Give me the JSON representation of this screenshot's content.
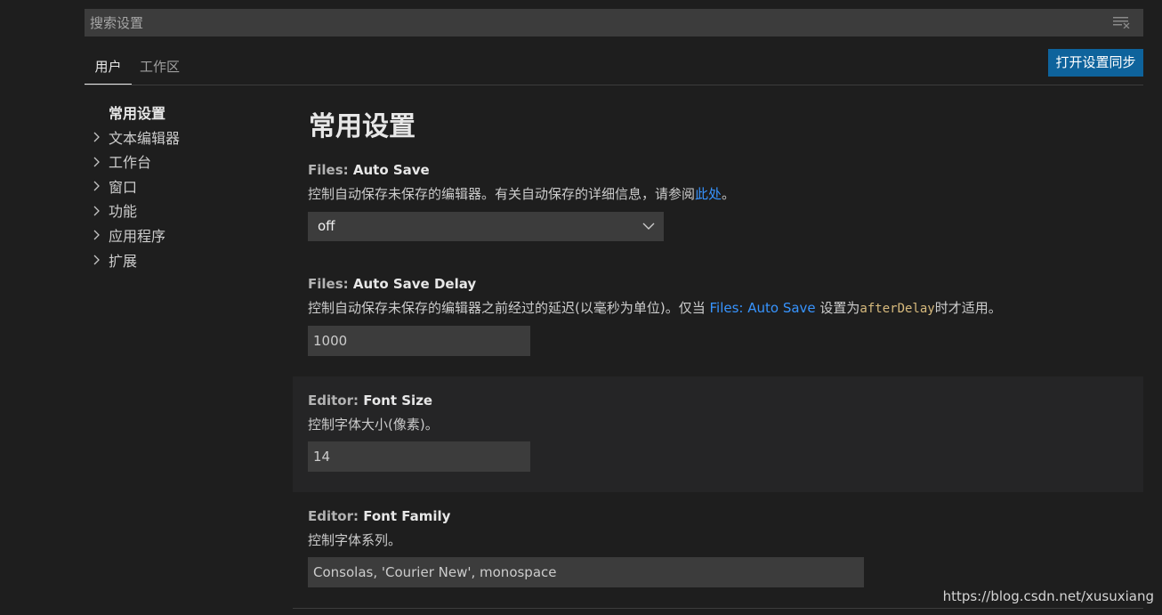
{
  "search": {
    "placeholder": "搜索设置",
    "filter_icon": "filter-list-icon"
  },
  "tabs": [
    {
      "label": "用户",
      "active": true
    },
    {
      "label": "工作区",
      "active": false
    }
  ],
  "sync_button": {
    "label": "打开设置同步",
    "color": "#0e639c"
  },
  "tree": {
    "header": "常用设置",
    "items": [
      {
        "label": "文本编辑器"
      },
      {
        "label": "工作台"
      },
      {
        "label": "窗口"
      },
      {
        "label": "功能"
      },
      {
        "label": "应用程序"
      },
      {
        "label": "扩展"
      }
    ]
  },
  "main": {
    "section_title": "常用设置",
    "settings": {
      "auto_save": {
        "category": "Files: ",
        "name": "Auto Save",
        "desc_prefix": "控制自动保存未保存的编辑器。有关自动保存的详细信息，请参阅",
        "desc_link": "此处",
        "desc_suffix": "。",
        "value": "off"
      },
      "auto_save_delay": {
        "category": "Files: ",
        "name": "Auto Save Delay",
        "desc_prefix": "控制自动保存未保存的编辑器之前经过的延迟(以毫秒为单位)。仅当 ",
        "desc_link": "Files: Auto Save",
        "desc_middle": " 设置为",
        "desc_code": "afterDelay",
        "desc_suffix": "时才适用。",
        "value": "1000"
      },
      "font_size": {
        "category": "Editor: ",
        "name": "Font Size",
        "desc": "控制字体大小(像素)。",
        "value": "14"
      },
      "font_family": {
        "category": "Editor: ",
        "name": "Font Family",
        "desc": "控制字体系列。",
        "value": "Consolas, 'Courier New', monospace"
      }
    }
  },
  "watermark": "https://blog.csdn.net/xusuxiang",
  "colors": {
    "background": "#1e1e1e",
    "input_bg": "#3c3c3c",
    "link": "#3794ff",
    "focused_row": "#252526"
  }
}
